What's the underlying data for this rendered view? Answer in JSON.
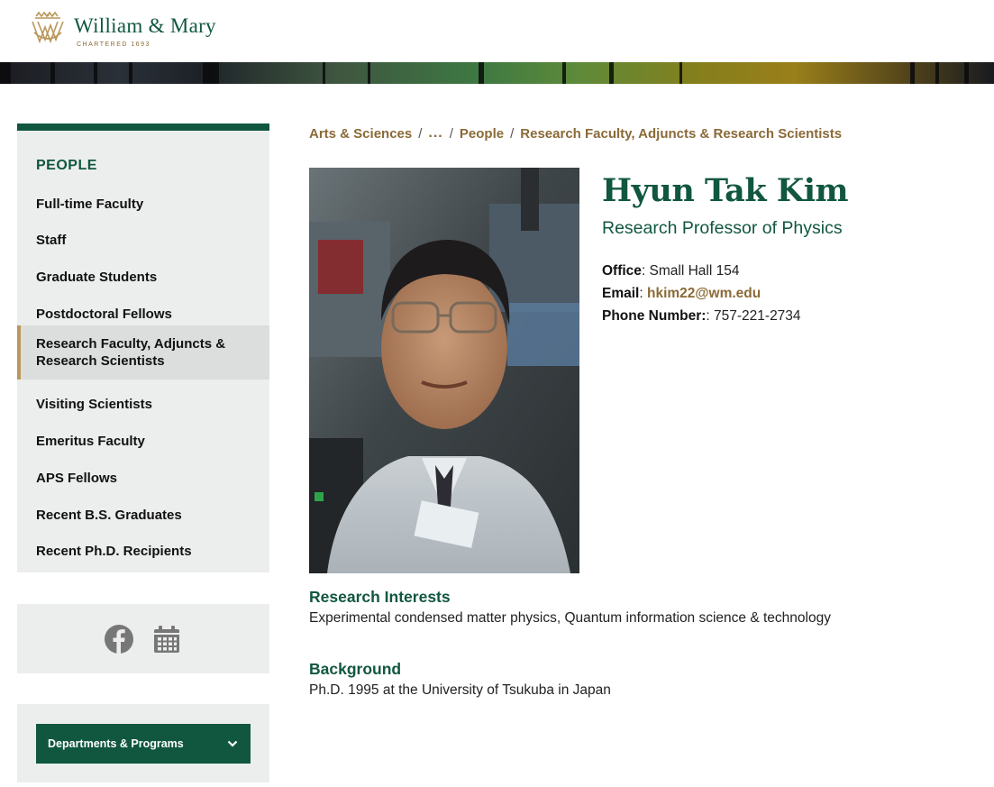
{
  "header": {
    "logo_name": "William & Mary",
    "logo_sub": "CHARTERED 1693"
  },
  "sidebar": {
    "heading": "PEOPLE",
    "items": [
      {
        "label": "Full-time Faculty"
      },
      {
        "label": "Staff"
      },
      {
        "label": "Graduate Students"
      },
      {
        "label": "Postdoctoral Fellows"
      },
      {
        "label": "Research Faculty, Adjuncts & Research Scientists",
        "active": true
      },
      {
        "label": "Visiting Scientists"
      },
      {
        "label": "Emeritus Faculty"
      },
      {
        "label": "APS Fellows"
      },
      {
        "label": "Recent B.S. Graduates"
      },
      {
        "label": "Recent Ph.D. Recipients"
      }
    ],
    "departments_label": "Departments & Programs"
  },
  "breadcrumb": {
    "items": [
      "Arts & Sciences",
      "...",
      "People",
      "Research Faculty, Adjuncts & Research Scientists"
    ]
  },
  "profile": {
    "name": "Hyun Tak Kim",
    "title": "Research Professor of Physics",
    "office_label": "Office",
    "office_value": ": Small Hall 154",
    "email_label": "Email",
    "email_value": "hkim22@wm.edu",
    "phone_label": "Phone Number:",
    "phone_value": ": 757-221-2734"
  },
  "sections": {
    "research_heading": "Research Interests",
    "research_text": "Experimental condensed matter physics, Quantum information science & technology",
    "background_heading": "Background",
    "background_text": "Ph.D. 1995 at the University of Tsukuba in Japan"
  },
  "colors": {
    "brand_green": "#115740",
    "brand_gold": "#8a6a37"
  },
  "icons": [
    "wm-cypher-logo-icon",
    "facebook-icon",
    "calendar-icon",
    "chevron-down-icon"
  ]
}
